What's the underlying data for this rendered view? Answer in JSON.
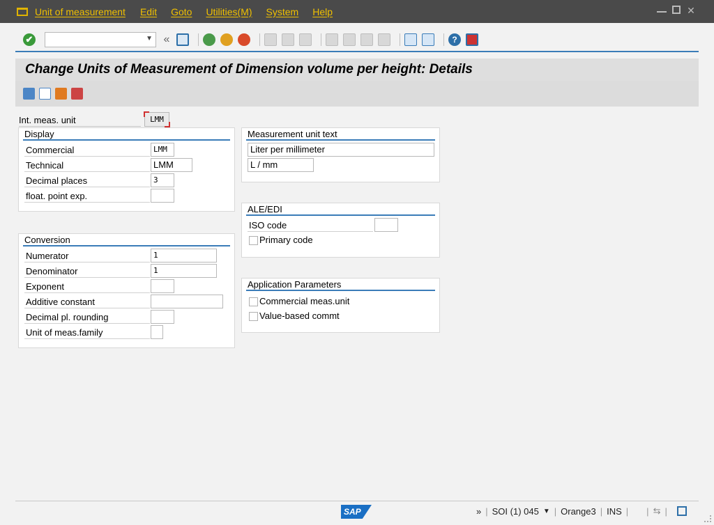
{
  "menubar": {
    "items": [
      "Unit of measurement",
      "Edit",
      "Goto",
      "Utilities(M)",
      "System",
      "Help"
    ]
  },
  "toolbar": {
    "command_field_value": "",
    "back_double": "«",
    "ok_glyph": "✔",
    "help_glyph": "?"
  },
  "title": "Change Units of Measurement of Dimension volume per height: Details",
  "header": {
    "label": "Int. meas. unit",
    "value": "LMM"
  },
  "display": {
    "title": "Display",
    "rows": [
      {
        "label": "Commercial",
        "value": "LMM"
      },
      {
        "label": "Technical",
        "value": "LMM"
      },
      {
        "label": "Decimal places",
        "value": "3"
      },
      {
        "label": "float. point exp.",
        "value": ""
      }
    ]
  },
  "conversion": {
    "title": "Conversion",
    "rows": [
      {
        "label": "Numerator",
        "value": "1"
      },
      {
        "label": "Denominator",
        "value": "1"
      },
      {
        "label": "Exponent",
        "value": ""
      },
      {
        "label": "Additive constant",
        "value": ""
      },
      {
        "label": "Decimal pl. rounding",
        "value": ""
      },
      {
        "label": "Unit of meas.family",
        "value": ""
      }
    ]
  },
  "measurement_text": {
    "title": "Measurement unit text",
    "long_text": "Liter per millimeter",
    "short_text": "L / mm"
  },
  "ale_edi": {
    "title": "ALE/EDI",
    "iso_label": "ISO code",
    "iso_value": "",
    "primary_code_label": "Primary code"
  },
  "app_params": {
    "title": "Application Parameters",
    "commercial_label": "Commercial meas.unit",
    "value_based_label": "Value-based commt"
  },
  "status": {
    "logo": "SAP",
    "arrows": "»",
    "system": "SOI (1) 045",
    "server": "Orange3",
    "mode": "INS"
  }
}
